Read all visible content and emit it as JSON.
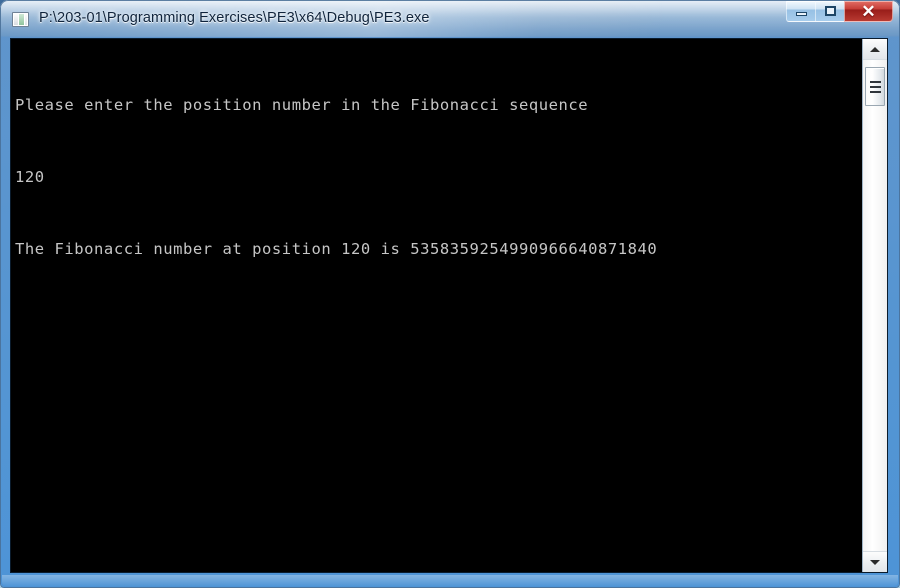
{
  "desktop": {
    "label": "desktop-wallpaper"
  },
  "window": {
    "title": "P:\\203-01\\Programming Exercises\\PE3\\x64\\Debug\\PE3.exe",
    "app_icon_name": "console-window-icon",
    "accent_frame_color": "#4a92d6",
    "titlebar_text_color": "#10243c",
    "controls": {
      "minimize_label": "",
      "minimize_tooltip": "Minimize",
      "maximize_label": "",
      "maximize_tooltip": "Maximize",
      "close_label": "✕",
      "close_tooltip": "Close",
      "close_color": "#c4342c"
    }
  },
  "console": {
    "background_color": "#000000",
    "text_color": "#c6c6c6",
    "lines": [
      "Please enter the position number in the Fibonacci sequence",
      "120",
      "The Fibonacci number at position 120 is 5358359254990966640871840"
    ],
    "prompt_text": "Please enter the position number in the Fibonacci sequence",
    "user_input": "120",
    "result_text": "The Fibonacci number at position 120 is 5358359254990966640871840",
    "fibonacci_position": "120",
    "fibonacci_value": "5358359254990966640871840"
  },
  "scrollbar": {
    "up_arrow_name": "scroll-up-arrow",
    "down_arrow_name": "scroll-down-arrow",
    "thumb_name": "scrollbar-thumb"
  }
}
